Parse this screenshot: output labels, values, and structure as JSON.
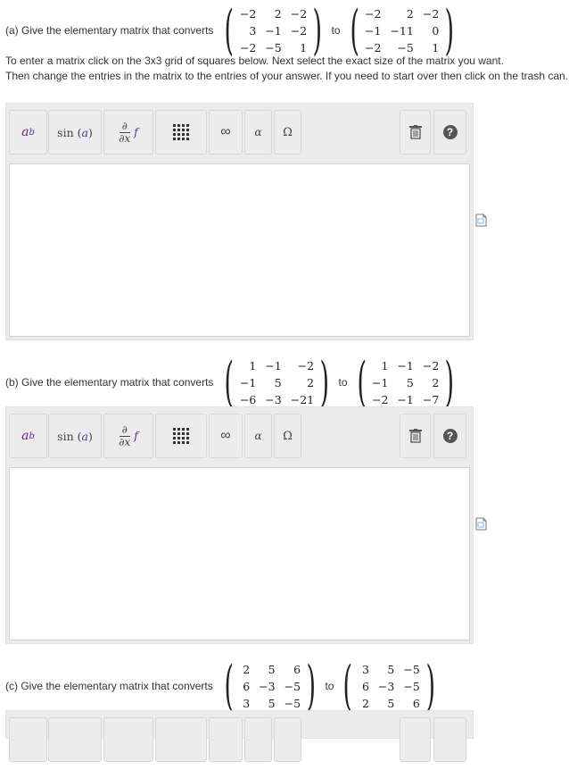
{
  "questions": [
    {
      "prompt": "(a) Give the elementary matrix that converts",
      "to": "to",
      "from_matrix": [
        [
          "−2",
          "2",
          "−2"
        ],
        [
          "3",
          "−1",
          "−2"
        ],
        [
          "−2",
          "−5",
          "1"
        ]
      ],
      "to_matrix": [
        [
          "−2",
          "2",
          "−2"
        ],
        [
          "−1",
          "−11",
          "0"
        ],
        [
          "−2",
          "−5",
          "1"
        ]
      ]
    },
    {
      "prompt": "(b) Give the elementary matrix that converts",
      "to": "to",
      "from_matrix": [
        [
          "1",
          "−1",
          "−2"
        ],
        [
          "−1",
          "5",
          "2"
        ],
        [
          "−6",
          "−3",
          "−21"
        ]
      ],
      "to_matrix": [
        [
          "1",
          "−1",
          "−2"
        ],
        [
          "−1",
          "5",
          "2"
        ],
        [
          "−2",
          "−1",
          "−7"
        ]
      ]
    },
    {
      "prompt": "(c) Give the elementary matrix that converts",
      "to": "to",
      "from_matrix": [
        [
          "2",
          "5",
          "6"
        ],
        [
          "6",
          "−3",
          "−5"
        ],
        [
          "3",
          "5",
          "−5"
        ]
      ],
      "to_matrix": [
        [
          "3",
          "5",
          "−5"
        ],
        [
          "6",
          "−3",
          "−5"
        ],
        [
          "2",
          "5",
          "6"
        ]
      ]
    }
  ],
  "instructions": {
    "line1": "To enter a matrix click on the 3x3 grid of squares below. Next select the exact size of the matrix you want.",
    "line2": "Then change the entries in the matrix to the entries of your answer. If you need to start over then click on the trash can."
  },
  "toolbar": {
    "superscript_base": "a",
    "superscript_exp": "b",
    "sin_fn": "sin",
    "sin_arg": "a",
    "deriv_num": "∂",
    "deriv_den": "∂x",
    "deriv_f": "f",
    "infinity": "∞",
    "alpha": "α",
    "omega": "Ω",
    "help": "?"
  },
  "icons": {
    "matrix": "matrix-grid-icon",
    "trash": "trash-icon",
    "help": "help-icon",
    "preview": "document-preview-icon"
  }
}
